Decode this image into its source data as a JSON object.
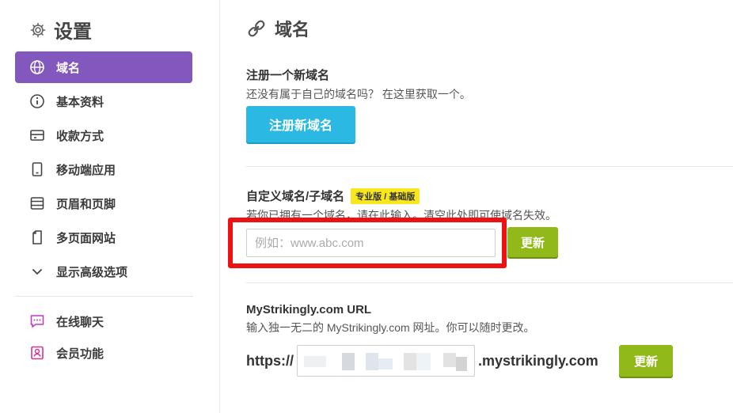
{
  "sidebar": {
    "title": "设置",
    "items": [
      {
        "label": "域名",
        "icon": "globe-icon",
        "active": true
      },
      {
        "label": "基本资料",
        "icon": "info-icon"
      },
      {
        "label": "收款方式",
        "icon": "wallet-icon"
      },
      {
        "label": "移动端应用",
        "icon": "mobile-icon"
      },
      {
        "label": "页眉和页脚",
        "icon": "layout-icon"
      },
      {
        "label": "多页面网站",
        "icon": "pages-icon"
      },
      {
        "label": "显示高级选项",
        "icon": "chevron-down-icon"
      }
    ],
    "extra_items": [
      {
        "label": "在线聊天",
        "icon": "chat-icon"
      },
      {
        "label": "会员功能",
        "icon": "member-icon"
      }
    ]
  },
  "main": {
    "title": "域名",
    "register": {
      "title": "注册一个新域名",
      "desc": "还没有属于自己的域名吗？ 在这里获取一个。",
      "button": "注册新域名"
    },
    "custom": {
      "title": "自定义域名/子域名",
      "badge": "专业版 / 基础版",
      "desc": "若你已拥有一个域名，请在此输入。清空此处即可使域名失效。",
      "placeholder": "例如：www.abc.com",
      "button": "更新"
    },
    "mystrikingly": {
      "title": "MyStrikingly.com URL",
      "desc": "输入独一无二的 MyStrikingly.com 网址。你可以随时更改。",
      "prefix": "https://",
      "suffix": ".mystrikingly.com",
      "button": "更新"
    }
  },
  "colors": {
    "accent_purple": "#8358be",
    "button_blue": "#2bb8e3",
    "button_green": "#90b919",
    "badge_yellow": "#f8e71c",
    "highlight_red": "#ee1111",
    "chat_icon": "#c03cc0",
    "member_icon": "#d6338f"
  }
}
